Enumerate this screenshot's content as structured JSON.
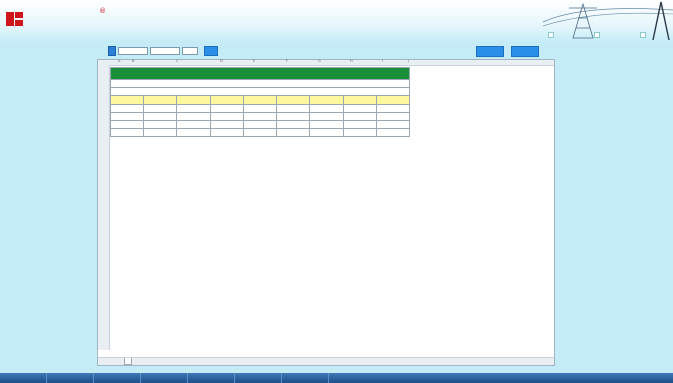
{
  "header": {
    "brand": "",
    "registered": "®",
    "title": "",
    "info": [
      "",
      "",
      "",
      ""
    ],
    "buttons": [
      "",
      "",
      ""
    ]
  },
  "toolbar": {
    "label": "",
    "start_value": "",
    "end_value": "",
    "extra_value": "",
    "query_button": "",
    "right_buttons": [
      "",
      ""
    ]
  },
  "sheet": {
    "columns": [
      "A",
      "B",
      "C",
      "D",
      "E",
      "F",
      "G",
      "H",
      "I",
      "J"
    ],
    "row_numbers": [
      "1",
      "2",
      "3",
      "4",
      "5",
      "6",
      "7",
      "8"
    ],
    "title": "",
    "subtitle": "",
    "table_title": "",
    "headers": [
      "",
      "",
      "",
      "",
      "",
      "",
      "",
      "",
      ""
    ],
    "rows": [
      [
        "",
        "",
        "",
        "",
        "",
        "",
        "",
        "",
        ""
      ],
      [
        "",
        "",
        "",
        "",
        "",
        "",
        "",
        "",
        ""
      ],
      [
        "",
        "",
        "",
        "",
        "",
        "",
        "",
        "",
        ""
      ],
      [
        "",
        "",
        "",
        "",
        "",
        "",
        "",
        "",
        ""
      ]
    ],
    "tab_nav": "",
    "tab_name": ""
  },
  "bottom_nav": [
    "",
    "",
    "",
    "",
    "",
    "",
    ""
  ],
  "colors": {
    "accent": "#2a8fe8",
    "title_bg": "#1a8f3a",
    "header_bg": "#fff7a0",
    "nav_bg": "#1e4f8a",
    "brand": "#c8101a"
  }
}
